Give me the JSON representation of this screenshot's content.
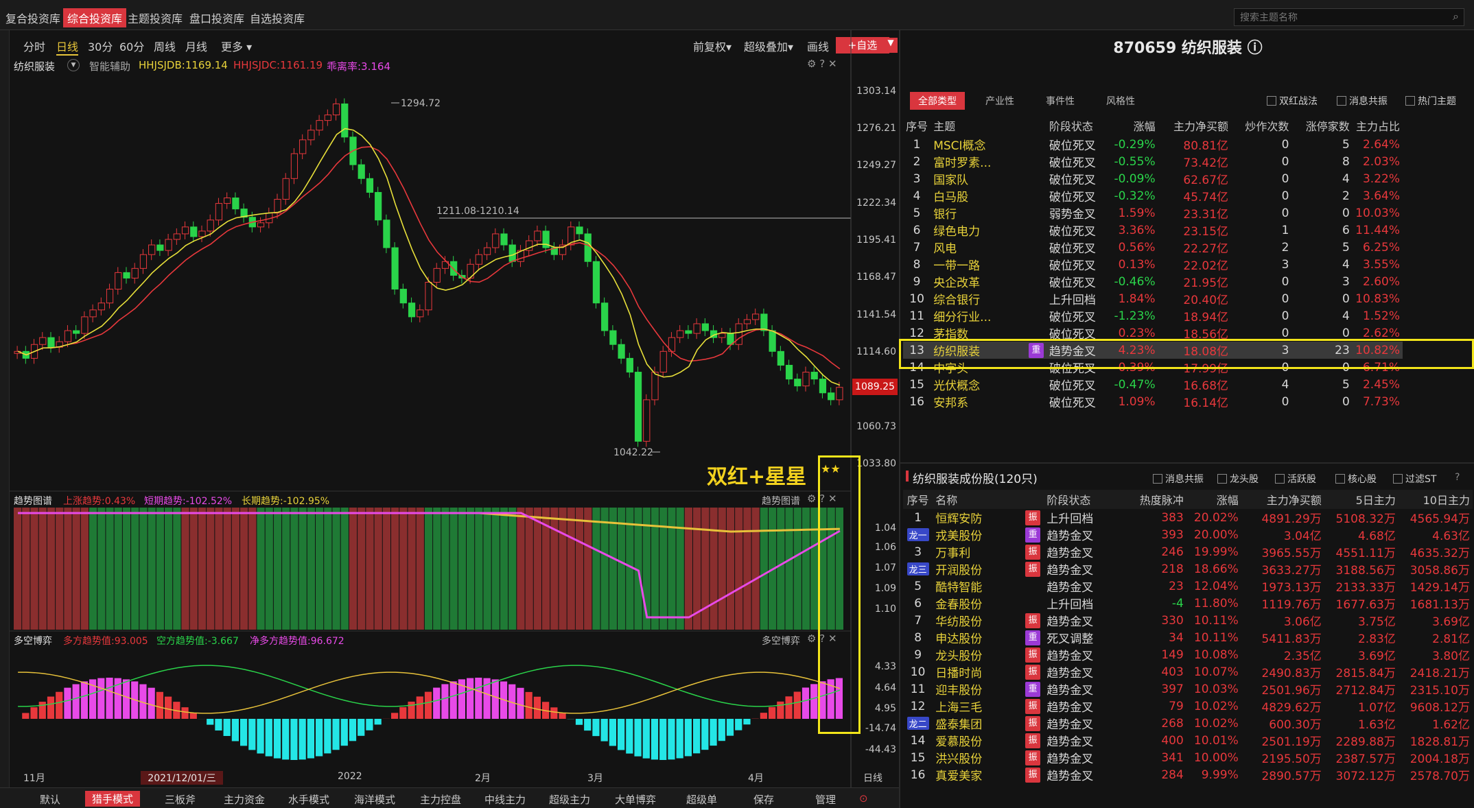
{
  "top_tabs": [
    "复合投资库",
    "综合投资库",
    "主题投资库",
    "盘口投资库",
    "自选投资库"
  ],
  "active_top_tab": 1,
  "search_placeholder": "搜索主题名称",
  "periods": [
    "分时",
    "日线",
    "30分",
    "60分",
    "周线",
    "月线",
    "更多 ▾"
  ],
  "active_period": 1,
  "chart_tools": [
    "前复权▾",
    "超级叠加▾",
    "画线"
  ],
  "add_watch": "+自选",
  "main_chart": {
    "name": "纺织服装",
    "assist": "智能辅助",
    "l1": "HHJSJDB:1169.14",
    "l2": "HHJSJDC:1161.19",
    "l3": "乖离率:3.164",
    "high_label": "1294.72",
    "low_label": "1042.22",
    "range_label": "1211.08-1210.14",
    "current_price": "1089.25"
  },
  "price_axis": [
    "1303.14",
    "1276.21",
    "1249.27",
    "1222.34",
    "1195.41",
    "1168.47",
    "1141.54",
    "1114.60",
    "1060.73",
    "1033.80"
  ],
  "trend_panel": {
    "name": "趋势图谱",
    "s1": "上涨趋势:0.43%",
    "s2": "短期趋势:-102.52%",
    "s3": "长期趋势:-102.95%",
    "axis": [
      "1.04",
      "1.06",
      "1.07",
      "1.09",
      "1.10"
    ]
  },
  "game_panel": {
    "name": "多空博弈",
    "s1": "多方趋势值:93.005",
    "s2": "空方趋势值:-3.667",
    "s3": "净多方趋势值:96.672",
    "axis": [
      "4.33",
      "4.64",
      "4.95",
      "-14.74",
      "-44.43"
    ]
  },
  "annotation": "双红+星星",
  "annotation_stars": "★★",
  "x_axis": {
    "labels": [
      "11月",
      "2022",
      "2月",
      "3月",
      "4月"
    ],
    "cursor_date": "2021/12/01/三",
    "right": "日线"
  },
  "bottom_tabs": [
    "默认",
    "猎手模式",
    "三板斧",
    "主力资金",
    "水手模式",
    "海洋模式",
    "主力控盘",
    "中线主力",
    "超级主力",
    "大单博弈",
    "超级单",
    "保存",
    "管理"
  ],
  "active_bottom_tab": 1,
  "stock_title": "870659 纺织服装 ⓘ",
  "filter_tabs": [
    "全部类型",
    "产业性",
    "事件性",
    "风格性"
  ],
  "filter_checks": [
    "双红战法",
    "消息共振",
    "热门主题"
  ],
  "themes_header": [
    "序号",
    "主题",
    "",
    "阶段状态",
    "涨幅",
    "主力净买额",
    "炒作次数",
    "涨停家数",
    "主力占比"
  ],
  "themes": [
    [
      "1",
      "MSCI概念",
      "",
      "破位死叉",
      "-0.29%",
      "80.81亿",
      "0",
      "5",
      "2.64%"
    ],
    [
      "2",
      "富时罗素...",
      "",
      "破位死叉",
      "-0.55%",
      "73.42亿",
      "0",
      "8",
      "2.03%"
    ],
    [
      "3",
      "国家队",
      "",
      "破位死叉",
      "-0.09%",
      "62.67亿",
      "0",
      "4",
      "3.22%"
    ],
    [
      "4",
      "白马股",
      "",
      "破位死叉",
      "-0.32%",
      "45.74亿",
      "0",
      "2",
      "3.64%"
    ],
    [
      "5",
      "银行",
      "",
      "弱势金叉",
      "1.59%",
      "23.31亿",
      "0",
      "0",
      "10.03%"
    ],
    [
      "6",
      "绿色电力",
      "",
      "破位死叉",
      "3.36%",
      "23.15亿",
      "1",
      "6",
      "11.44%"
    ],
    [
      "7",
      "风电",
      "",
      "破位死叉",
      "0.56%",
      "22.27亿",
      "2",
      "5",
      "6.25%"
    ],
    [
      "8",
      "一带一路",
      "",
      "破位死叉",
      "0.13%",
      "22.02亿",
      "3",
      "4",
      "3.55%"
    ],
    [
      "9",
      "央企改革",
      "",
      "破位死叉",
      "-0.46%",
      "21.95亿",
      "0",
      "3",
      "2.60%"
    ],
    [
      "10",
      "综合银行",
      "",
      "上升回档",
      "1.84%",
      "20.40亿",
      "0",
      "0",
      "10.83%"
    ],
    [
      "11",
      "细分行业...",
      "",
      "破位死叉",
      "-1.23%",
      "18.94亿",
      "0",
      "4",
      "1.52%"
    ],
    [
      "12",
      "茅指数",
      "",
      "破位死叉",
      "0.23%",
      "18.56亿",
      "0",
      "0",
      "2.62%"
    ],
    [
      "13",
      "纺织服装",
      "重",
      "趋势金叉",
      "4.23%",
      "18.08亿",
      "3",
      "23",
      "10.82%"
    ],
    [
      "14",
      "中字头",
      "",
      "破位死叉",
      "0.39%",
      "17.99亿",
      "0",
      "0",
      "6.71%"
    ],
    [
      "15",
      "光伏概念",
      "",
      "破位死叉",
      "-0.47%",
      "16.68亿",
      "4",
      "5",
      "2.45%"
    ],
    [
      "16",
      "安邦系",
      "",
      "破位死叉",
      "1.09%",
      "16.14亿",
      "0",
      "0",
      "7.73%"
    ]
  ],
  "stocks_title": "纺织服装成份股(120只)",
  "stock_checks": [
    "消息共振",
    "龙头股",
    "活跃股",
    "核心股",
    "过滤ST"
  ],
  "stocks_header": [
    "序号",
    "名称",
    "",
    "阶段状态",
    "热度脉冲",
    "涨幅",
    "主力净买额",
    "5日主力",
    "10日主力"
  ],
  "stocks": [
    [
      "1",
      "",
      "恒辉安防",
      "振",
      "上升回档",
      "383",
      "20.02%",
      "4891.29万",
      "5108.32万",
      "4565.94万"
    ],
    [
      "2",
      "龙一",
      "戎美股份",
      "重",
      "趋势金叉",
      "393",
      "20.00%",
      "3.04亿",
      "4.68亿",
      "4.63亿"
    ],
    [
      "3",
      "",
      "万事利",
      "振",
      "趋势金叉",
      "246",
      "19.99%",
      "3965.55万",
      "4551.11万",
      "4635.32万"
    ],
    [
      "4",
      "龙三",
      "开润股份",
      "振",
      "趋势金叉",
      "218",
      "18.66%",
      "3633.27万",
      "3188.56万",
      "3058.86万"
    ],
    [
      "5",
      "",
      "酷特智能",
      "",
      "趋势金叉",
      "23",
      "12.04%",
      "1973.13万",
      "2133.33万",
      "1429.14万"
    ],
    [
      "6",
      "",
      "金春股份",
      "",
      "上升回档",
      "-4",
      "11.80%",
      "1119.76万",
      "1677.63万",
      "1681.13万"
    ],
    [
      "7",
      "",
      "华纺股份",
      "振",
      "趋势金叉",
      "330",
      "10.11%",
      "3.06亿",
      "3.75亿",
      "3.69亿"
    ],
    [
      "8",
      "",
      "申达股份",
      "重",
      "死叉调整",
      "34",
      "10.11%",
      "5411.83万",
      "2.83亿",
      "2.81亿"
    ],
    [
      "9",
      "",
      "龙头股份",
      "振",
      "趋势金叉",
      "149",
      "10.08%",
      "2.35亿",
      "3.69亿",
      "3.80亿"
    ],
    [
      "10",
      "",
      "日播时尚",
      "振",
      "趋势金叉",
      "403",
      "10.07%",
      "2490.83万",
      "2815.84万",
      "2418.21万"
    ],
    [
      "11",
      "",
      "迎丰股份",
      "重",
      "趋势金叉",
      "397",
      "10.03%",
      "2501.96万",
      "2712.84万",
      "2315.10万"
    ],
    [
      "12",
      "",
      "上海三毛",
      "振",
      "趋势金叉",
      "79",
      "10.02%",
      "4829.62万",
      "1.07亿",
      "9608.12万"
    ],
    [
      "13",
      "龙二",
      "盛泰集团",
      "振",
      "趋势金叉",
      "268",
      "10.02%",
      "600.30万",
      "1.63亿",
      "1.62亿"
    ],
    [
      "14",
      "",
      "爱慕股份",
      "振",
      "趋势金叉",
      "400",
      "10.01%",
      "2501.19万",
      "2289.88万",
      "1828.81万"
    ],
    [
      "15",
      "",
      "洪兴股份",
      "振",
      "趋势金叉",
      "341",
      "10.00%",
      "2195.50万",
      "2387.57万",
      "2004.18万"
    ],
    [
      "16",
      "",
      "真爱美家",
      "振",
      "趋势金叉",
      "284",
      "9.99%",
      "2890.57万",
      "3072.12万",
      "2578.70万"
    ]
  ],
  "colors": {
    "up": "#e8383c",
    "down": "#2ad44a",
    "yellow": "#e8d23a",
    "magenta": "#e84ae8",
    "accent": "#d9363e",
    "highlight": "#f3e51a"
  }
}
